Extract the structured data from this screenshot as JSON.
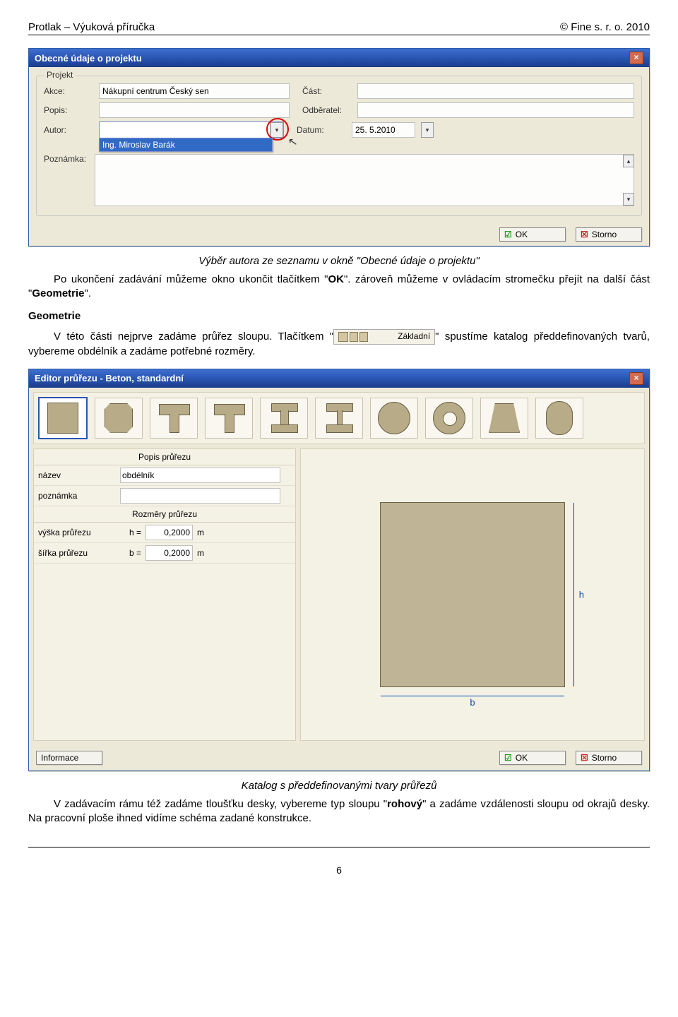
{
  "header": {
    "left": "Protlak – Výuková příručka",
    "right": "© Fine s. r. o. 2010"
  },
  "dialog1": {
    "title": "Obecné údaje o projektu",
    "fieldset_label": "Projekt",
    "labels": {
      "akce": "Akce:",
      "cast": "Část:",
      "popis": "Popis:",
      "odberatel": "Odběratel:",
      "autor": "Autor:",
      "datum": "Datum:",
      "poznamka": "Poznámka:"
    },
    "values": {
      "akce": "Nákupní centrum Český sen",
      "cast": "",
      "popis": "",
      "odberatel": "",
      "datum": "25. 5.2010",
      "author_option": "Ing. Miroslav Barák"
    },
    "buttons": {
      "ok": "OK",
      "storno": "Storno"
    }
  },
  "caption1": "Výběr autora ze seznamu v okně \"Obecné údaje o projektu\"",
  "para1a": "Po ukončení zadávání můžeme okno ukončit tlačítkem \"",
  "para1a_ok": "OK",
  "para1b": "\". zároveň můžeme v ovládacím stromečku přejít na další část \"",
  "para1b_geo": "Geometrie",
  "para1c": "\".",
  "h3_geo": "Geometrie",
  "para2a": "V této části nejprve zadáme průřez sloupu. Tlačítkem \"",
  "inline_button_label": "Základní",
  "para2b": "\" spustíme katalog předdefinovaných tvarů, vybereme obdélník a zadáme potřebné rozměry.",
  "dialog2": {
    "title": "Editor průřezu - Beton, standardní",
    "popis_hdr": "Popis průřezu",
    "name_label": "název",
    "name_value": "obdélník",
    "note_label": "poznámka",
    "rozmery_hdr": "Rozměry průřezu",
    "h_label": "výška průřezu",
    "h_sym": "h =",
    "h_val": "0,2000",
    "h_unit": "m",
    "b_label": "šířka průřezu",
    "b_sym": "b =",
    "b_val": "0,2000",
    "b_unit": "m",
    "dim_h": "h",
    "dim_b": "b",
    "btn_info": "Informace",
    "btn_ok": "OK",
    "btn_storno": "Storno"
  },
  "caption2": "Katalog s předdefinovanými tvary průřezů",
  "para3a": "V zadávacím rámu též zadáme tloušťku desky, vybereme typ sloupu \"",
  "para3a_bold": "rohový",
  "para3b": "\" a zadáme vzdálenosti sloupu od okrajů desky. Na pracovní ploše ihned vidíme schéma zadané konstrukce.",
  "pagenum": "6"
}
